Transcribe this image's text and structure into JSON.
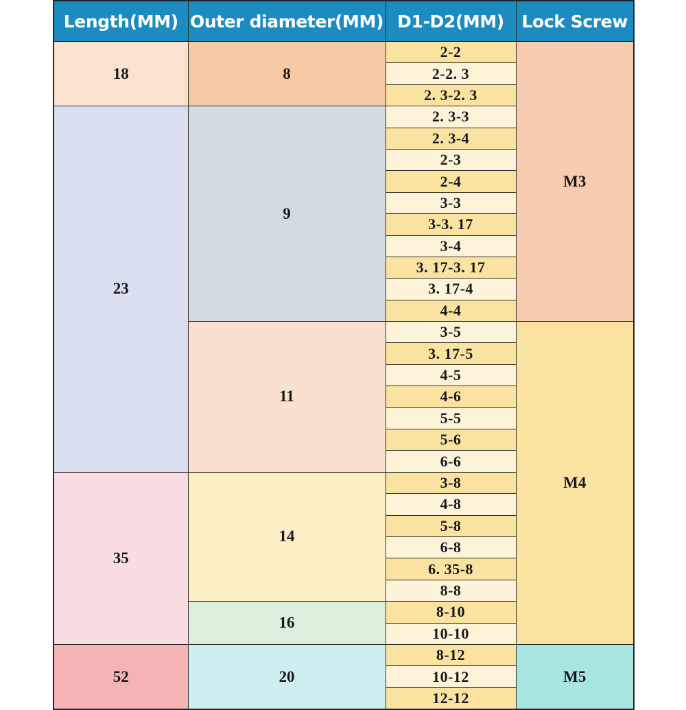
{
  "table": {
    "headers": [
      "Length(MM)",
      "Outer diameter(MM)",
      "D1-D2(MM)",
      "Lock Screw"
    ],
    "rows": [
      {
        "d1d2": "2-2"
      },
      {
        "d1d2": "2-2. 3"
      },
      {
        "d1d2": "2. 3-2. 3"
      },
      {
        "d1d2": "2. 3-3"
      },
      {
        "d1d2": "2. 3-4"
      },
      {
        "d1d2": "2-3"
      },
      {
        "d1d2": "2-4"
      },
      {
        "d1d2": "3-3"
      },
      {
        "d1d2": "3-3. 17"
      },
      {
        "d1d2": "3-4"
      },
      {
        "d1d2": "3. 17-3. 17"
      },
      {
        "d1d2": "3. 17-4"
      },
      {
        "d1d2": "4-4"
      },
      {
        "d1d2": "3-5"
      },
      {
        "d1d2": "3. 17-5"
      },
      {
        "d1d2": "4-5"
      },
      {
        "d1d2": "4-6"
      },
      {
        "d1d2": "5-5"
      },
      {
        "d1d2": "5-6"
      },
      {
        "d1d2": "6-6"
      },
      {
        "d1d2": "3-8"
      },
      {
        "d1d2": "4-8"
      },
      {
        "d1d2": "5-8"
      },
      {
        "d1d2": "6-8"
      },
      {
        "d1d2": "6. 35-8"
      },
      {
        "d1d2": "8-8"
      },
      {
        "d1d2": "8-10"
      },
      {
        "d1d2": "10-10"
      },
      {
        "d1d2": "8-12"
      },
      {
        "d1d2": "10-12"
      },
      {
        "d1d2": "12-12"
      }
    ],
    "length_groups": [
      {
        "value": "18",
        "span": 3
      },
      {
        "value": "23",
        "span": 17
      },
      {
        "value": "35",
        "span": 8
      },
      {
        "value": "52",
        "span": 3
      }
    ],
    "outer_diameter_groups": [
      {
        "value": "8",
        "span": 3
      },
      {
        "value": "9",
        "span": 10
      },
      {
        "value": "11",
        "span": 7
      },
      {
        "value": "14",
        "span": 6
      },
      {
        "value": "16",
        "span": 2
      },
      {
        "value": "20",
        "span": 3
      }
    ],
    "lock_screw_groups": [
      {
        "value": "M3",
        "span": 13
      },
      {
        "value": "M4",
        "span": 15
      },
      {
        "value": "M5",
        "span": 3
      }
    ]
  },
  "colors": {
    "header_blue": "#1c8bbf",
    "length_18": "#fae2ce",
    "length_23": "#dadff0",
    "length_35": "#fadce3",
    "length_52": "#f5b3b5",
    "od_8": "#f5c9a5",
    "od_9": "#d4dae2",
    "od_11": "#fae0d1",
    "od_14": "#fbeec4",
    "od_16": "#dceedc",
    "od_20": "#cdefef",
    "d1d2_odd": "#fae3a0",
    "d1d2_even": "#fdf3d8",
    "lock_m3": "#f7ccb0",
    "lock_m4": "#fae3a0",
    "lock_m5": "#a9e5e0",
    "grid_line": "#2b2a20"
  }
}
